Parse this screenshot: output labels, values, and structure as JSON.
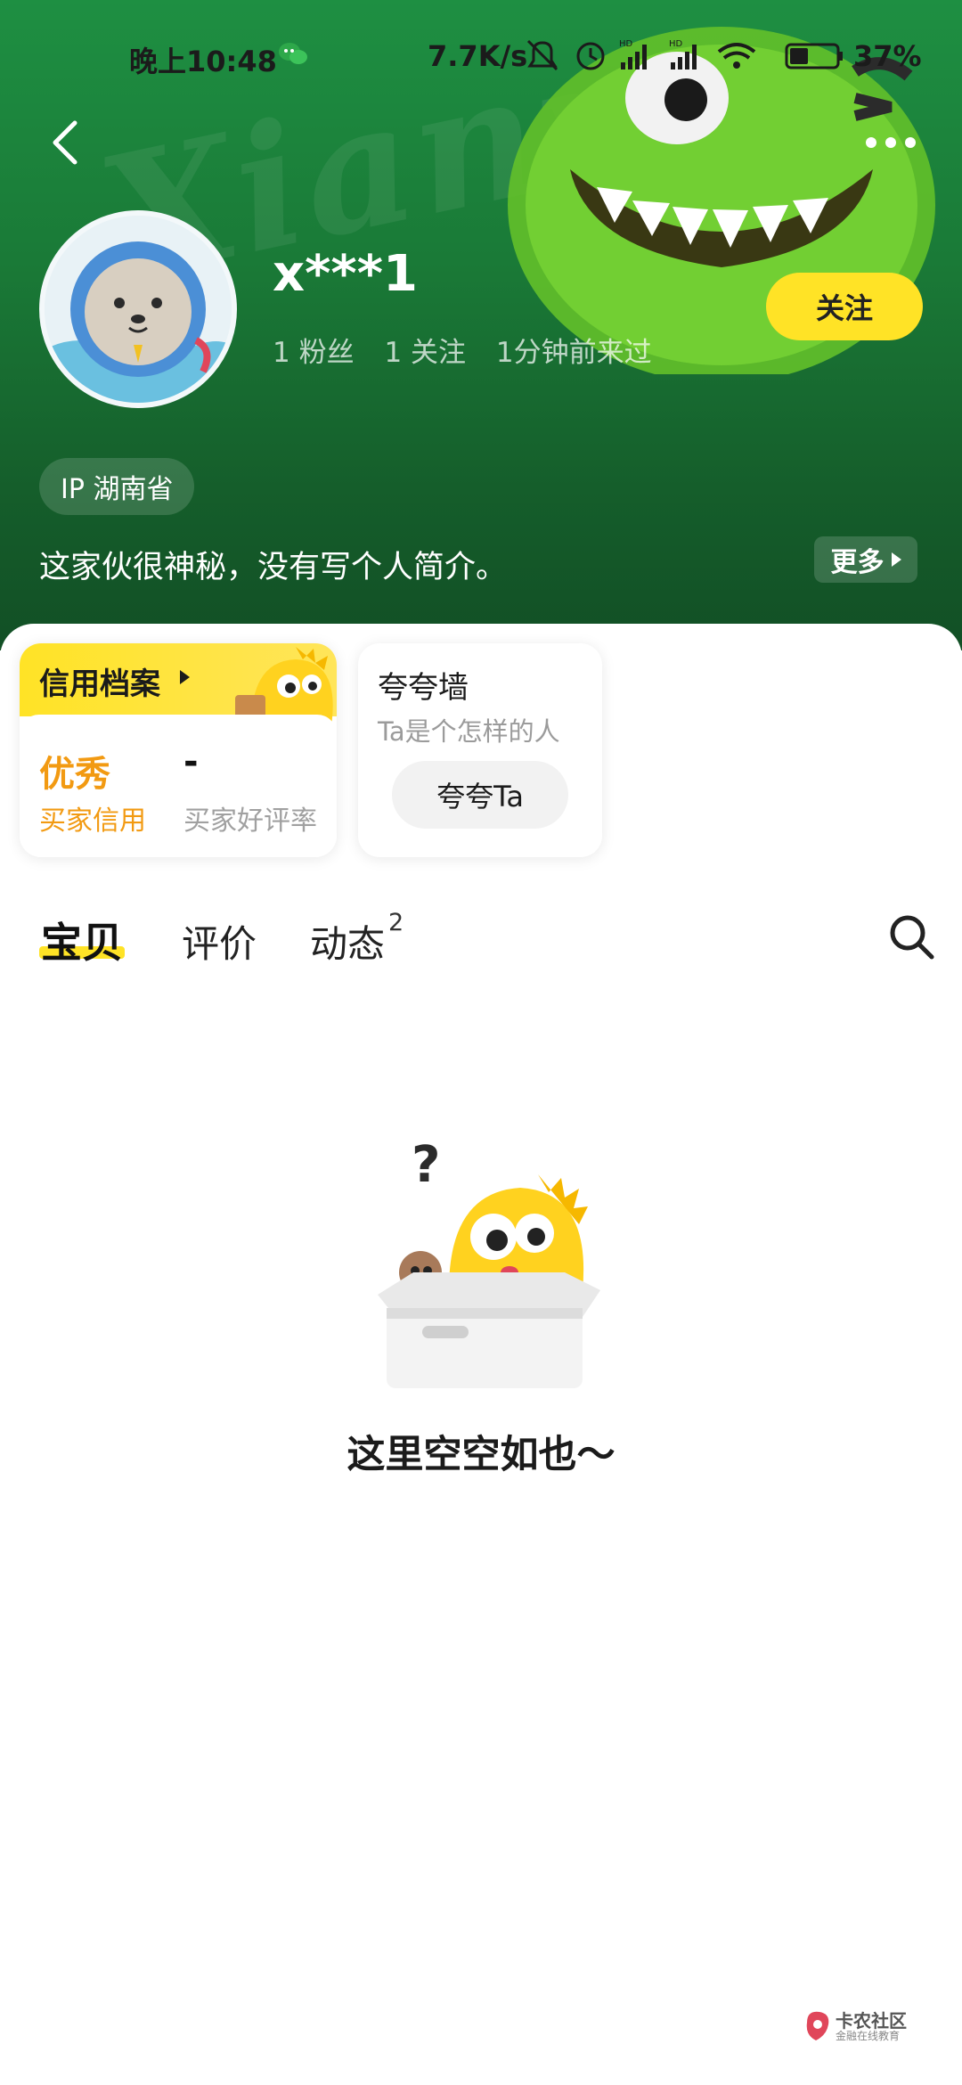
{
  "status_bar": {
    "time": "晚上10:48",
    "net_speed": "7.7K/s",
    "battery": "37%",
    "icons": [
      "wechat-icon",
      "mute-icon",
      "alarm-icon",
      "signal-hd-1-icon",
      "signal-hd-2-icon",
      "wifi-icon",
      "battery-icon"
    ]
  },
  "nav": {
    "back_icon": "chevron-left-icon",
    "more_icon": "more-dots-icon"
  },
  "profile": {
    "username": "x***1",
    "fans": "1 粉丝",
    "following": "1 关注",
    "last_seen": "1分钟前来过",
    "follow_label": "关注",
    "ip": "IP 湖南省",
    "bio": "这家伙很神秘，没有写个人简介。",
    "more_label": "更多"
  },
  "credit": {
    "title": "信用档案",
    "credit_value": "优秀",
    "credit_label": "买家信用",
    "rate_value": "-",
    "rate_label": "买家好评率"
  },
  "praise": {
    "title": "夸夸墙",
    "subtitle": "Ta是个怎样的人",
    "button_label": "夸夸Ta"
  },
  "tabs": [
    {
      "label": "宝贝",
      "active": true
    },
    {
      "label": "评价",
      "active": false
    },
    {
      "label": "动态",
      "active": false,
      "badge": "2"
    }
  ],
  "empty_state": {
    "text": "这里空空如也～"
  },
  "watermark_brand": {
    "name": "卡农社区",
    "sub": "金融在线教育"
  },
  "colors": {
    "accent": "#ffe326",
    "header_green": "#1a7a37",
    "credit_orange": "#f29a12"
  }
}
